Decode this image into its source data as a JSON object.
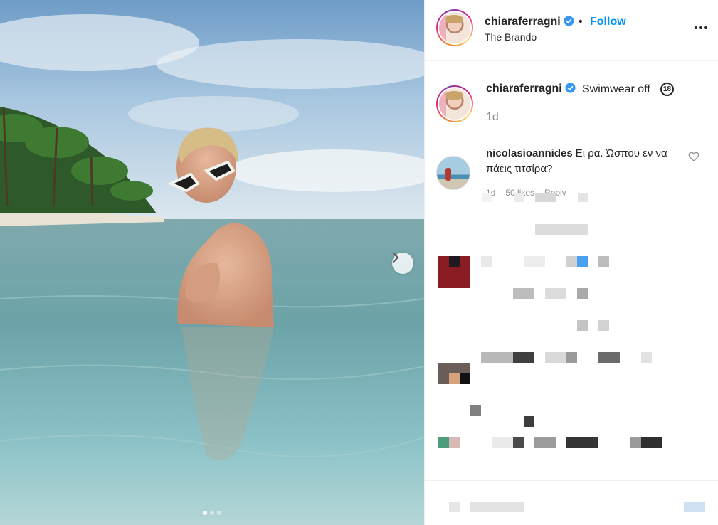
{
  "post": {
    "username": "chiaraferragni",
    "follow_label": "Follow",
    "bullet": "•",
    "location": "The Brando",
    "caption_text": "Swimwear off",
    "caption_badge": "18",
    "caption_time": "1d",
    "carousel": {
      "slide_count": 3,
      "active_slide": 1
    }
  },
  "comment": {
    "username": "nicolasioannides",
    "text": "Ει ρα. Ώσπου εν να πάεις τιτσίρα?",
    "time": "1d",
    "likes": "50 likes",
    "reply": "Reply"
  },
  "icons": {
    "verified": "verified-badge-icon",
    "more": "more-options-icon",
    "heart": "heart-outline-icon",
    "next": "chevron-right-icon"
  },
  "colors": {
    "link": "#0095f6",
    "verified": "#3897f0",
    "muted": "#8e8e8e",
    "text": "#262626"
  }
}
